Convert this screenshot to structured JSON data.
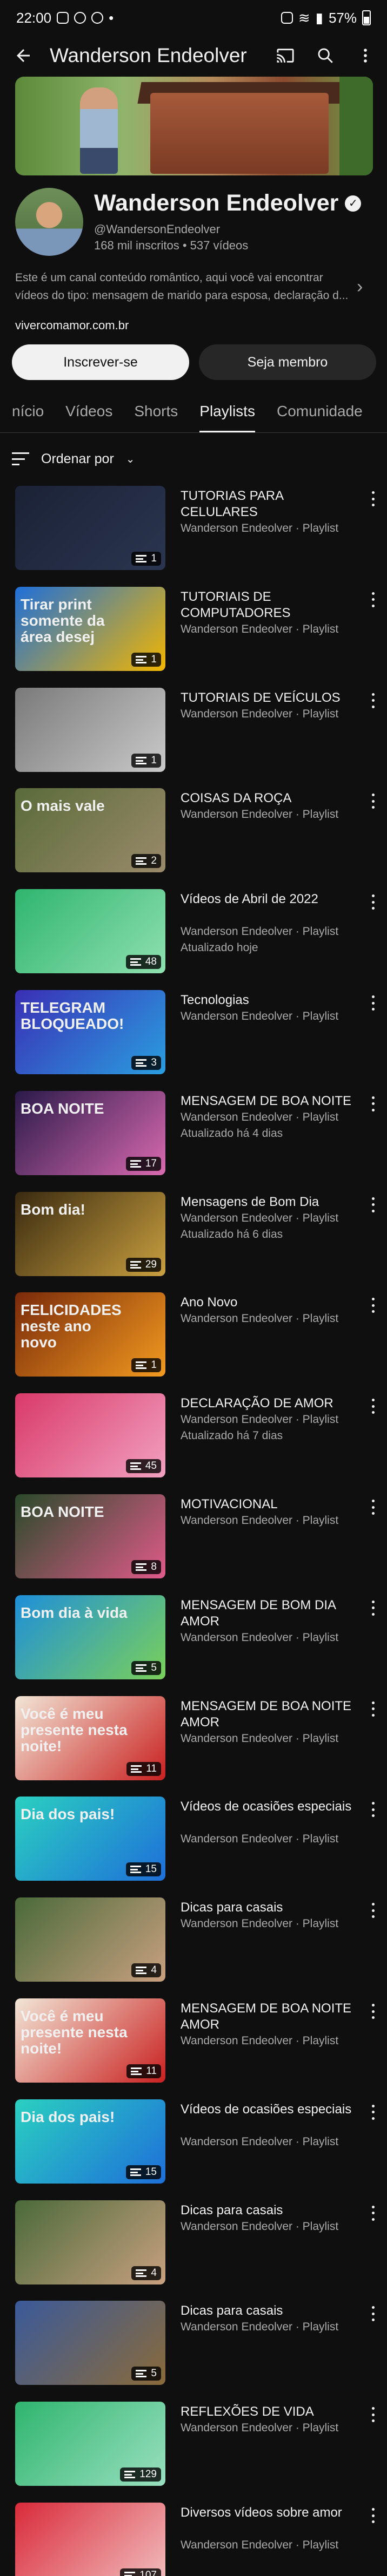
{
  "status_bar": {
    "time": "22:00",
    "battery": "57%"
  },
  "header": {
    "title": "Wanderson Endeolver"
  },
  "channel": {
    "name": "Wanderson Endeolver",
    "handle": "@WandersonEndeolver",
    "stats": "168 mil inscritos • 537 vídeos",
    "description": "Este é um canal conteúdo romântico, aqui você vai encontrar vídeos do tipo: mensagem de marido para esposa, declaração d...",
    "link": "vivercomamor.com.br",
    "subscribe_label": "Inscrever-se",
    "member_label": "Seja membro"
  },
  "tabs": [
    "nício",
    "Vídeos",
    "Shorts",
    "Playlists",
    "Comunidade"
  ],
  "active_tab": "Playlists",
  "sort_label": "Ordenar por",
  "playlists": [
    {
      "title": "TUTORIAS PARA CELULARES",
      "owner": "Wanderson Endeolver · Playlist",
      "updated": "",
      "count": "1",
      "thumb_text": "",
      "colors": [
        "#1b2236",
        "#2a3550"
      ]
    },
    {
      "title": "TUTORIAIS DE COMPUTADORES",
      "owner": "Wanderson Endeolver · Playlist",
      "updated": "",
      "count": "1",
      "thumb_text": "Tirar print somente da área desej",
      "colors": [
        "#1e6fd9",
        "#f2b600"
      ]
    },
    {
      "title": "TUTORIAIS DE VEÍCULOS",
      "owner": "Wanderson Endeolver · Playlist",
      "updated": "",
      "count": "1",
      "thumb_text": "",
      "colors": [
        "#7a7a7a",
        "#c9c9c9"
      ]
    },
    {
      "title": "COISAS DA ROÇA",
      "owner": "Wanderson Endeolver · Playlist",
      "updated": "",
      "count": "2",
      "thumb_text": "O mais vale",
      "colors": [
        "#5a6b3a",
        "#9a8a6a"
      ]
    },
    {
      "title": "Vídeos de Abril de 2022",
      "owner": "Wanderson Endeolver · Playlist",
      "updated": "Atualizado hoje",
      "count": "48",
      "thumb_text": "",
      "colors": [
        "#2fb56e",
        "#8fe0b0"
      ]
    },
    {
      "title": "Tecnologias",
      "owner": "Wanderson Endeolver · Playlist",
      "updated": "",
      "count": "3",
      "thumb_text": "TELEGRAM BLOQUEADO!",
      "colors": [
        "#3a2fb5",
        "#2a9ee0"
      ]
    },
    {
      "title": "MENSAGEM DE BOA NOITE",
      "owner": "Wanderson Endeolver · Playlist",
      "updated": "Atualizado há 4 dias",
      "count": "17",
      "thumb_text": "BOA NOITE",
      "colors": [
        "#2a1a4a",
        "#d96ab0"
      ]
    },
    {
      "title": "Mensagens de Bom Dia",
      "owner": "Wanderson Endeolver · Playlist",
      "updated": "Atualizado há 6 dias",
      "count": "29",
      "thumb_text": "Bom dia!",
      "colors": [
        "#3a2a10",
        "#c9a040"
      ]
    },
    {
      "title": "Ano Novo",
      "owner": "Wanderson Endeolver · Playlist",
      "updated": "",
      "count": "1",
      "thumb_text": "FELICIDADES neste ano novo",
      "colors": [
        "#7a2a0a",
        "#f29a20"
      ]
    },
    {
      "title": "DECLARAÇÃO DE AMOR",
      "owner": "Wanderson Endeolver · Playlist",
      "updated": "Atualizado há 7 dias",
      "count": "45",
      "thumb_text": "",
      "colors": [
        "#d93a6a",
        "#f2a0c0"
      ]
    },
    {
      "title": "MOTIVACIONAL",
      "owner": "Wanderson Endeolver · Playlist",
      "updated": "",
      "count": "8",
      "thumb_text": "BOA NOITE",
      "colors": [
        "#2a4a2a",
        "#e05a8a"
      ]
    },
    {
      "title": "MENSAGEM DE BOM DIA AMOR",
      "owner": "Wanderson Endeolver · Playlist",
      "updated": "",
      "count": "5",
      "thumb_text": "Bom dia à vida",
      "colors": [
        "#1e8fd9",
        "#7ad05a"
      ]
    },
    {
      "title": "MENSAGEM DE BOA NOITE AMOR",
      "owner": "Wanderson Endeolver · Playlist",
      "updated": "",
      "count": "11",
      "thumb_text": "Você é meu presente nesta noite!",
      "colors": [
        "#f2e6d6",
        "#c92020"
      ]
    },
    {
      "title": "Vídeos de ocasiões especiais",
      "owner": "Wanderson Endeolver · Playlist",
      "updated": "",
      "count": "15",
      "thumb_text": "Dia dos pais!",
      "colors": [
        "#2ad0c0",
        "#1e6fd9"
      ]
    },
    {
      "title": "Dicas para casais",
      "owner": "Wanderson Endeolver · Playlist",
      "updated": "",
      "count": "4",
      "thumb_text": "",
      "colors": [
        "#4a6a3a",
        "#c9a080"
      ]
    },
    {
      "title": "MENSAGEM DE BOA NOITE AMOR",
      "owner": "Wanderson Endeolver · Playlist",
      "updated": "",
      "count": "11",
      "thumb_text": "Você é meu presente nesta noite!",
      "colors": [
        "#f2e6d6",
        "#c92020"
      ]
    },
    {
      "title": "Vídeos de ocasiões especiais",
      "owner": "Wanderson Endeolver · Playlist",
      "updated": "",
      "count": "15",
      "thumb_text": "Dia dos pais!",
      "colors": [
        "#2ad0c0",
        "#1e6fd9"
      ]
    },
    {
      "title": "Dicas para casais",
      "owner": "Wanderson Endeolver · Playlist",
      "updated": "",
      "count": "4",
      "thumb_text": "",
      "colors": [
        "#4a6a3a",
        "#c9a080"
      ]
    },
    {
      "title": "Dicas para casais",
      "owner": "Wanderson Endeolver · Playlist",
      "updated": "",
      "count": "5",
      "thumb_text": "",
      "colors": [
        "#3a5a9a",
        "#8a6a3a"
      ]
    },
    {
      "title": "REFLEXÕES DE VIDA",
      "owner": "Wanderson Endeolver · Playlist",
      "updated": "",
      "count": "129",
      "thumb_text": "",
      "colors": [
        "#2fb56e",
        "#9ae0c0"
      ]
    },
    {
      "title": "Diversos vídeos sobre amor",
      "owner": "Wanderson Endeolver · Playlist",
      "updated": "",
      "count": "107",
      "thumb_text": "",
      "colors": [
        "#d92a3a",
        "#f2c0c0"
      ]
    }
  ]
}
